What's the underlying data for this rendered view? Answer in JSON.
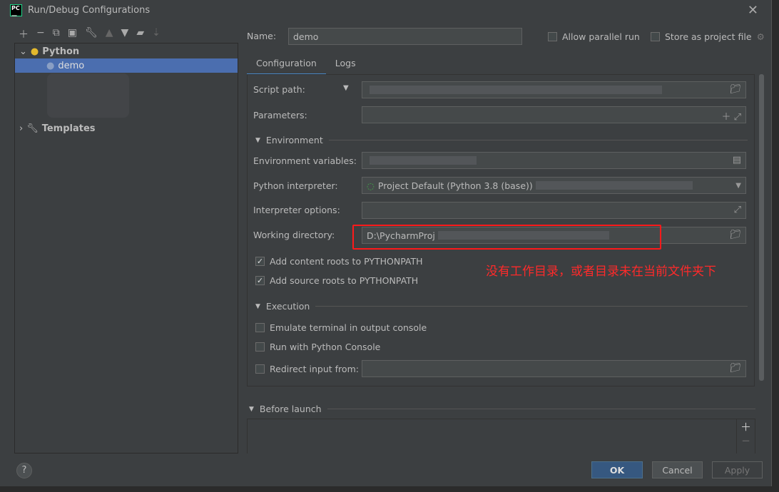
{
  "window": {
    "title": "Run/Debug Configurations",
    "logo": "PC"
  },
  "toolbar": {
    "icons": [
      "plus-icon",
      "minus-icon",
      "copy-icon",
      "save-icon",
      "wrench-icon",
      "arrow-up-icon",
      "arrow-down-icon",
      "new-folder-icon",
      "sort-icon"
    ]
  },
  "tree": {
    "python": "Python",
    "demo": "demo",
    "templates": "Templates"
  },
  "form": {
    "name_label": "Name:",
    "name_value": "demo",
    "allow_parallel": "Allow parallel run",
    "store_project": "Store as project file",
    "tabs": [
      "Configuration",
      "Logs"
    ],
    "script_path": "Script path:",
    "parameters": "Parameters:",
    "environment": "Environment",
    "env_vars": "Environment variables:",
    "interpreter": "Python interpreter:",
    "interpreter_value": "Project Default (Python 3.8 (base))",
    "interpreter_options": "Interpreter options:",
    "working_dir": "Working directory:",
    "working_dir_value": "D:\\PycharmProj",
    "content_roots": "Add content roots to PYTHONPATH",
    "source_roots": "Add source roots to PYTHONPATH",
    "execution": "Execution",
    "emulate": "Emulate terminal in output console",
    "python_console": "Run with Python Console",
    "redirect": "Redirect input from:",
    "before_launch": "Before launch"
  },
  "annotation": "没有工作目录，或者目录未在当前文件夹下",
  "buttons": {
    "ok": "OK",
    "cancel": "Cancel",
    "apply": "Apply",
    "help": "?"
  },
  "colors": {
    "accent": "#4b6eaf",
    "ok": "#365880",
    "annotation": "#ff2a2a"
  }
}
